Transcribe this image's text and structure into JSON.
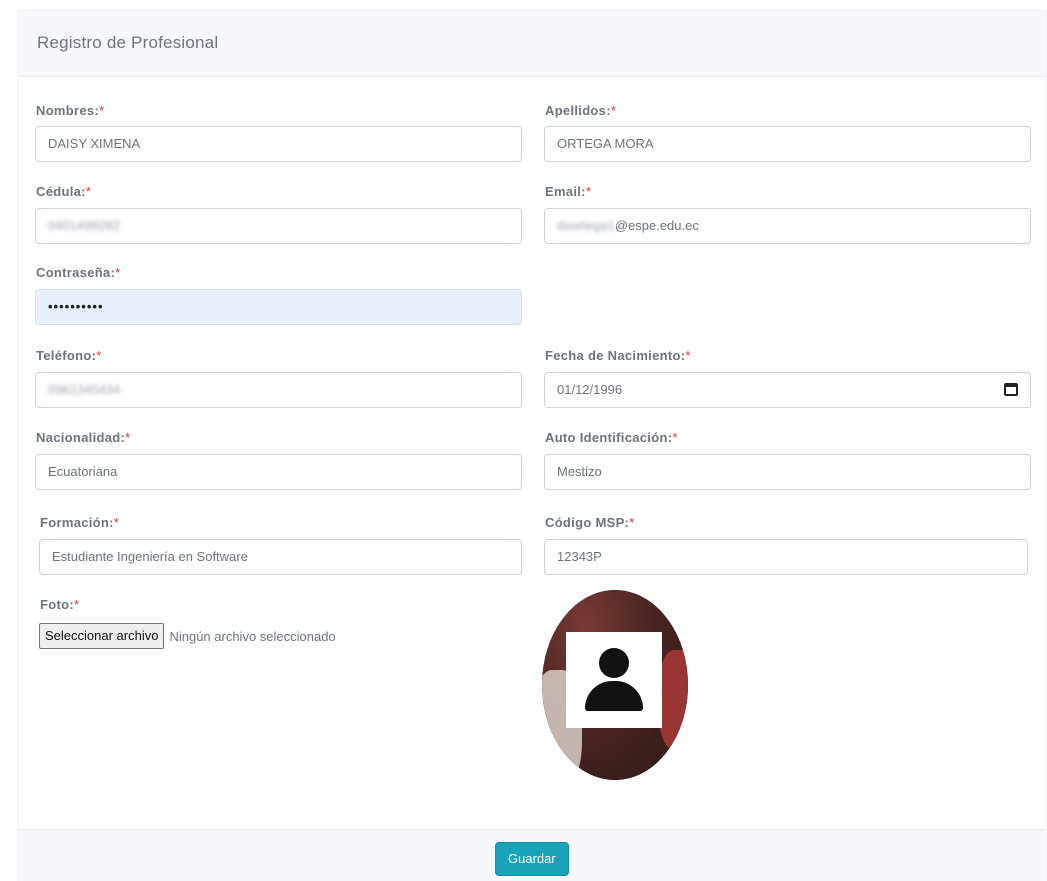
{
  "form": {
    "title": "Registro de Profesional",
    "required_mark": "*",
    "nombres": {
      "label": "Nombres:",
      "value": "DAISY XIMENA"
    },
    "apellidos": {
      "label": "Apellidos:",
      "value": "ORTEGA MORA"
    },
    "cedula": {
      "label": "Cédula:",
      "value": "0401498282"
    },
    "email": {
      "label": "Email:",
      "value_hidden": "dxortega1",
      "value_visible": "@espe.edu.ec"
    },
    "contrasena": {
      "label": "Contraseña:",
      "value": "••••••••••"
    },
    "telefono": {
      "label": "Teléfono:",
      "value": "0961345434"
    },
    "fecha_nacimiento": {
      "label": "Fecha de Nacimiento:",
      "value": "01/12/1996"
    },
    "nacionalidad": {
      "label": "Nacionalidad:",
      "value": "Ecuatoriana"
    },
    "auto_identificacion": {
      "label": "Auto Identificación:",
      "value": "Mestizo"
    },
    "formacion": {
      "label": "Formación:",
      "value": "Estudiante Ingeniería en Software"
    },
    "codigo_msp": {
      "label": "Código MSP:",
      "value": "12343P"
    },
    "foto": {
      "label": "Foto:",
      "button_label": "Seleccionar archivo",
      "status": "Ningún archivo seleccionado"
    }
  },
  "footer": {
    "save_label": "Guardar"
  },
  "colors": {
    "accent": "#17a2b8",
    "required": "#e3342f",
    "autofill": "#e8f0fe"
  }
}
